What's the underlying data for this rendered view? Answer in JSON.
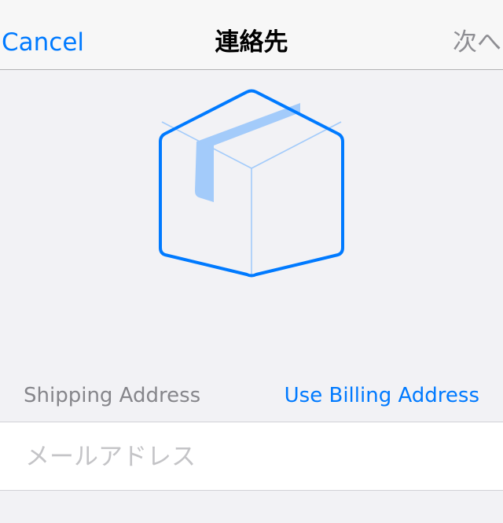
{
  "nav": {
    "cancel_label": "Cancel",
    "title": "連絡先",
    "next_label": "次へ"
  },
  "hero": {
    "icon": "package-box-icon"
  },
  "section": {
    "label": "Shipping Address",
    "billing_link": "Use Billing Address"
  },
  "email_field": {
    "value": "",
    "placeholder": "メールアドレス"
  },
  "colors": {
    "accent": "#007aff",
    "accent_light": "#a3cbfa",
    "disabled_text": "#8e8e93",
    "section_text": "#86868b",
    "placeholder": "#c4c4c7",
    "background": "#f2f2f5"
  }
}
